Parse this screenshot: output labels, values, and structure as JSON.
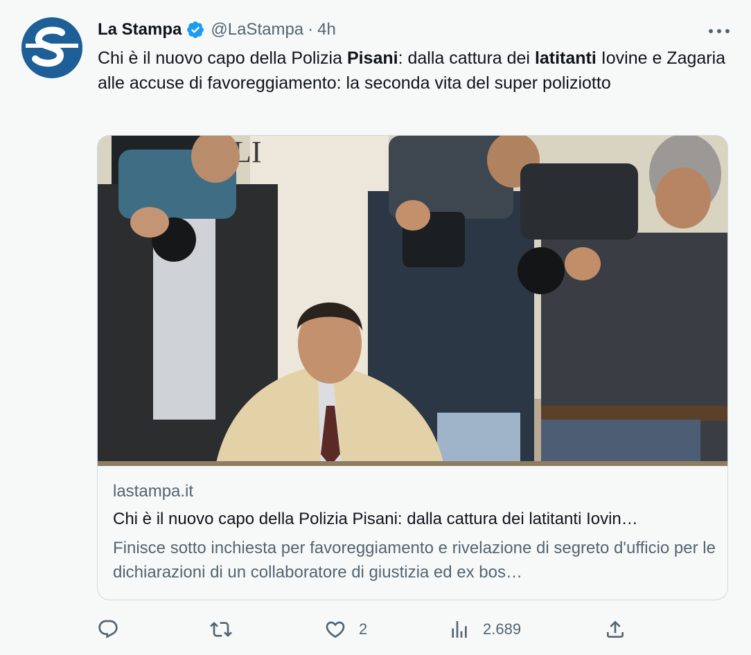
{
  "tweet": {
    "author_name": "La Stampa",
    "handle": "@LaStampa",
    "separator": "·",
    "time": "4h",
    "text_parts": [
      {
        "text": "Chi è il nuovo capo della Polizia ",
        "bold": false
      },
      {
        "text": "Pisani",
        "bold": true
      },
      {
        "text": ": dalla cattura dei ",
        "bold": false
      },
      {
        "text": "latitanti",
        "bold": true
      },
      {
        "text": " Iovine e Zagaria alle accuse di favoreggiamento: la seconda vita del super poliziotto",
        "bold": false
      }
    ]
  },
  "card": {
    "domain": "lastampa.it",
    "title": "Chi è il nuovo capo della Polizia Pisani: dalla cattura dei latitanti Iovin…",
    "description": "Finisce sotto inchiesta per favoreggiamento e rivelazione di segreto d'ufficio per le dichiarazioni di un collaboratore di giustizia ed ex bos…",
    "image_caption": "Man in a beige jacket seated at a table surrounded by TV camera operators"
  },
  "actions": {
    "reply_count": "",
    "retweet_count": "",
    "like_count": "2",
    "views_count": "2.689"
  },
  "icons": {
    "avatar": "la-stampa-logo",
    "verified": "verified-badge-icon",
    "more": "more-icon",
    "reply": "reply-icon",
    "retweet": "retweet-icon",
    "like": "heart-icon",
    "views": "views-icon",
    "share": "share-icon"
  },
  "colors": {
    "background": "#f7f9f9",
    "text_primary": "#0f1419",
    "text_secondary": "#536471",
    "verified_blue": "#1d9bf0",
    "avatar_blue": "#1d5f96",
    "border": "#cfd9de"
  }
}
